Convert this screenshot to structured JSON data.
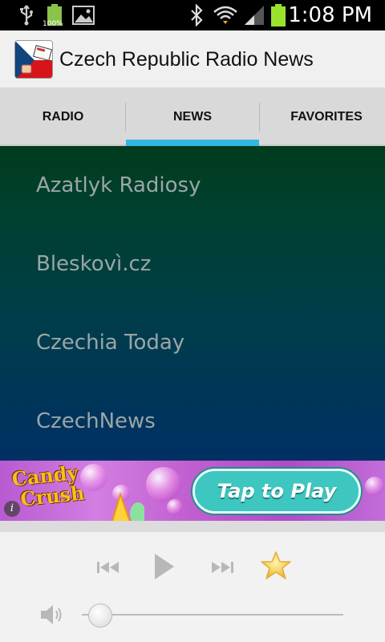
{
  "status_bar": {
    "time": "1:08 PM",
    "battery_percent": "100%",
    "icons": [
      "usb-icon",
      "battery-full-icon",
      "gallery-icon",
      "bluetooth-icon",
      "wifi-icon",
      "signal-icon",
      "battery-icon"
    ]
  },
  "app_bar": {
    "title": "Czech Republic Radio News",
    "logo_icon": "czech-flag-news-icon"
  },
  "tabs": [
    {
      "label": "RADIO",
      "selected": false
    },
    {
      "label": "NEWS",
      "selected": true
    },
    {
      "label": "FAVORITES",
      "selected": false
    }
  ],
  "news_list": [
    {
      "label": "Azatlyk Radiosy"
    },
    {
      "label": "Bleskovì.cz"
    },
    {
      "label": "Czechia Today"
    },
    {
      "label": "CzechNews"
    }
  ],
  "ad": {
    "brand_line1": "Candy",
    "brand_line2": "Crush",
    "cta": "Tap to Play",
    "info_glyph": "i"
  },
  "player": {
    "prev_icon": "skip-previous-icon",
    "play_icon": "play-icon",
    "next_icon": "skip-next-icon",
    "favorite_icon": "star-icon",
    "volume_icon": "speaker-icon",
    "volume_level": 0.07
  },
  "colors": {
    "tab_indicator": "#33b5e5",
    "list_text": "#9aa6a6",
    "gradient_top": "#003b1d",
    "gradient_bottom": "#003064",
    "star": "#f5c431"
  }
}
